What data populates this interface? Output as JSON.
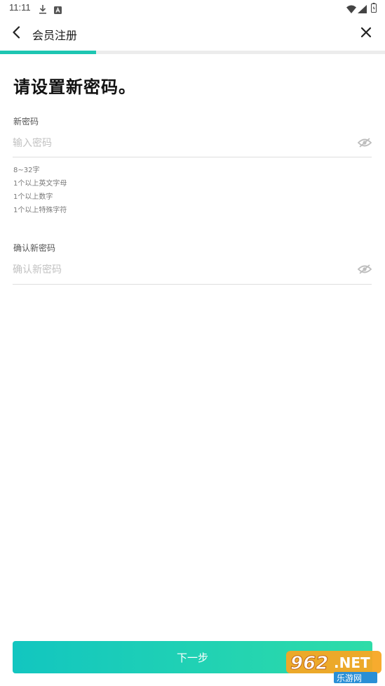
{
  "status_bar": {
    "time": "11:11",
    "icons": [
      "download-icon",
      "notification-icon",
      "wifi-icon",
      "signal-icon",
      "battery-icon"
    ]
  },
  "nav": {
    "title": "会员注册",
    "back_icon": "chevron-left-icon",
    "close_icon": "close-icon"
  },
  "progress": {
    "fraction": 0.25,
    "color": "#1ec6b2"
  },
  "page": {
    "title": "请设置新密码。"
  },
  "new_password": {
    "label": "新密码",
    "placeholder": "输入密码",
    "value": "",
    "toggle_icon": "eye-off-icon"
  },
  "rules": [
    "8~32字",
    "1个以上英文字母",
    "1个以上数字",
    "1个以上特殊字符"
  ],
  "confirm_password": {
    "label": "确认新密码",
    "placeholder": "确认新密码",
    "value": "",
    "toggle_icon": "eye-off-icon"
  },
  "next_button": {
    "label": "下一步",
    "gradient": [
      "#12c6c0",
      "#2edca8"
    ]
  },
  "watermark": {
    "number": "962",
    "suffix": ".NET",
    "tagline": "乐游网"
  }
}
